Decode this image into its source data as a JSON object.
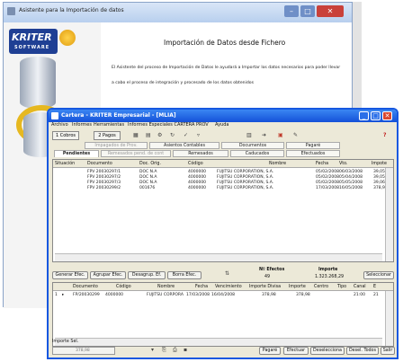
{
  "wizard": {
    "title": "Asistente para la Importación de datos",
    "logo_text": "KRITER",
    "logo_sub": "SOFTWARE",
    "heading": "Importación de Datos desde Fichero",
    "line1": "El Asistente del proceso de Importación de Datos le ayudará a Importar los datos necesarios para poder llevar",
    "line2": "a cabo el proceso de integración y procesado de los datos obtenidos"
  },
  "app": {
    "title": "Cartera - KRITER Empresarial - [MLIA]",
    "menu": [
      "Archivo",
      "Informes",
      "Herramientas",
      "Informes Especiales CARTERA PROV",
      "Ayuda"
    ],
    "toolbar": {
      "cobros": "1 Cobros",
      "pagos": "2 Pagos",
      "help_icon": "question-icon"
    },
    "tabs_row1": [
      "Impagados de Prov.",
      "Asientos Contables",
      "Documentos",
      "Pagaré"
    ],
    "tabs_row2": [
      "Pendientes",
      "Remesados pend. de cont",
      "Remesados",
      "Caducados",
      "Efectuados"
    ],
    "upper_headers": [
      "Situación",
      "Documento",
      "Doc. Orig.",
      "Código",
      "Nombre",
      "Fecha",
      "Vto.",
      "Impote"
    ],
    "upper_rows": [
      [
        "FPV 20030297/1",
        "DOC N.A",
        "4000000",
        "FUJITSU CORPORATION, S.A.",
        "05/02/2008",
        "06/03/2008",
        "39,05"
      ],
      [
        "FPV 20030297/2",
        "DOC N.A",
        "4000000",
        "FUJITSU CORPORATION, S.A.",
        "05/02/2008",
        "05/04/2008",
        "39,05"
      ],
      [
        "FPV 20030297/3",
        "DOC N.A",
        "4000000",
        "FUJITSU CORPORATION, S.A.",
        "05/02/2008",
        "05/05/2008",
        "39,06"
      ],
      [
        "FPV 20030299/2",
        "001676",
        "4000000",
        "FUJITSU CORPORATION, S.A.",
        "17/03/2008",
        "16/05/2008",
        "378,98"
      ]
    ],
    "buttons": {
      "generar": "Generar Efec.",
      "agrupar": "Agrupar Efec.",
      "desagrup": "Desagrup. Ef.",
      "borra": "Borra Efec.",
      "seleccionar": "Seleccionar"
    },
    "summary": {
      "n_label": "Nº Efectos",
      "n_value": "49",
      "imp_label": "Importe",
      "imp_value": "1.323.268,29"
    },
    "lower_headers": [
      "Documento",
      "Código",
      "Nombre",
      "Fecha",
      "Vencimiento",
      "Importe Divisa",
      "Importe",
      "Centro",
      "Tipo",
      "Canal",
      "E"
    ],
    "lower_row": {
      "num": "1",
      "doc": "FP/20030299",
      "codigo": "4000000",
      "nombre": "FUJITSU CORPORA",
      "fecha": "17/03/2008",
      "venc": "16/04/2008",
      "imp_div": "378,98",
      "imp": "378,98",
      "tipo": "21:00",
      "e": "21"
    },
    "importe_sel_label": "Importe Sel.",
    "importe_sel_value": "378,98",
    "bottom_buttons": [
      "Pagaré",
      "Efectuar",
      "Deselecciona",
      "Desel. Todos",
      "Salir"
    ]
  }
}
